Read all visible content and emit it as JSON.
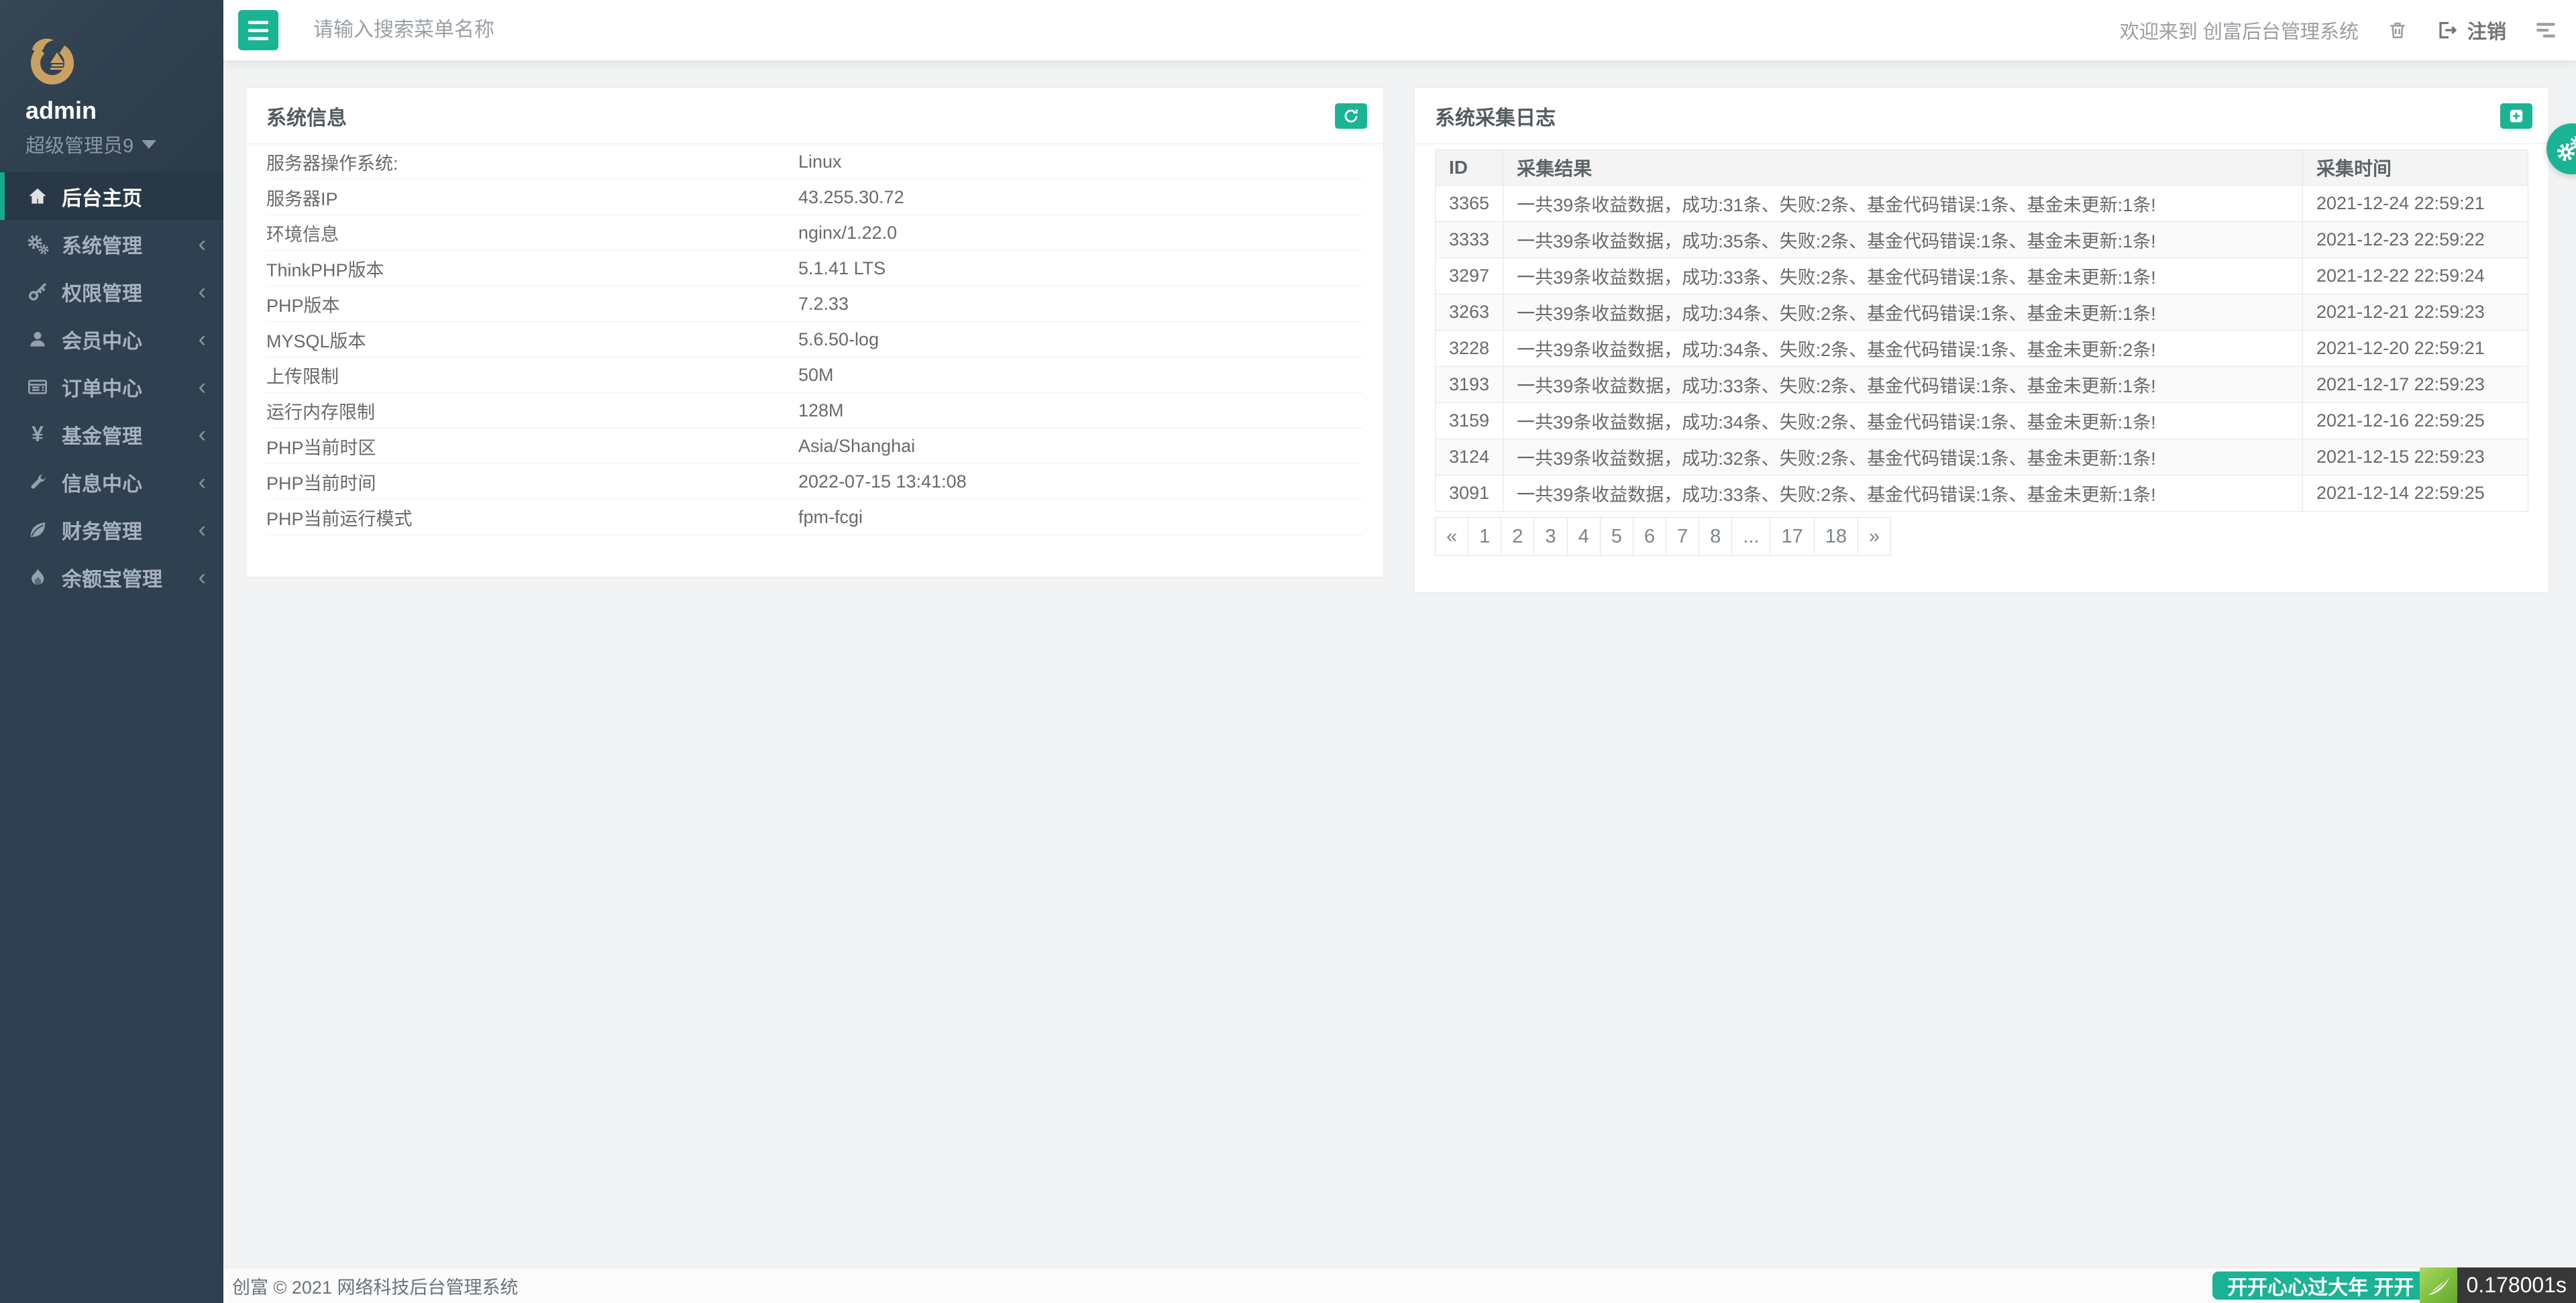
{
  "colors": {
    "accent": "#1ab394",
    "sidebar_bg": "#2f4050",
    "active_border": "#19aa8d",
    "body_bg": "#f2f3f4",
    "gold_logo": "#c9a162",
    "tp_green": "#7fbf3f"
  },
  "sidebar": {
    "username": "admin",
    "role": "超级管理员9",
    "menu": [
      {
        "label": "后台主页",
        "icon": "home-icon",
        "active": true
      },
      {
        "label": "系统管理",
        "icon": "gears-icon",
        "chevron": "‹"
      },
      {
        "label": "权限管理",
        "icon": "key-icon",
        "chevron": "‹"
      },
      {
        "label": "会员中心",
        "icon": "user-icon",
        "chevron": "‹"
      },
      {
        "label": "订单中心",
        "icon": "order-list-icon",
        "chevron": "‹"
      },
      {
        "label": "基金管理",
        "icon": "yen-icon",
        "chevron": "‹",
        "yen": "¥"
      },
      {
        "label": "信息中心",
        "icon": "wrench-icon",
        "chevron": "‹"
      },
      {
        "label": "财务管理",
        "icon": "leaf-icon",
        "chevron": "‹"
      },
      {
        "label": "余额宝管理",
        "icon": "flame-icon",
        "chevron": "‹"
      }
    ]
  },
  "topbar": {
    "search_placeholder": "请输入搜索菜单名称",
    "welcome": "欢迎来到 创富后台管理系统",
    "logout_label": "注销"
  },
  "panels": {
    "system_info": {
      "title": "系统信息",
      "rows": [
        {
          "label": "服务器操作系统:",
          "value": "Linux"
        },
        {
          "label": "服务器IP",
          "value": "43.255.30.72"
        },
        {
          "label": "环境信息",
          "value": "nginx/1.22.0"
        },
        {
          "label": "ThinkPHP版本",
          "value": "5.1.41 LTS"
        },
        {
          "label": "PHP版本",
          "value": "7.2.33"
        },
        {
          "label": "MYSQL版本",
          "value": "5.6.50-log"
        },
        {
          "label": "上传限制",
          "value": "50M"
        },
        {
          "label": "运行内存限制",
          "value": "128M"
        },
        {
          "label": "PHP当前时区",
          "value": "Asia/Shanghai"
        },
        {
          "label": "PHP当前时间",
          "value": "2022-07-15 13:41:08"
        },
        {
          "label": "PHP当前运行模式",
          "value": "fpm-fcgi"
        }
      ]
    },
    "collect_log": {
      "title": "系统采集日志",
      "columns": {
        "id": "ID",
        "result": "采集结果",
        "time": "采集时间"
      },
      "rows": [
        {
          "id": "3365",
          "result": "一共39条收益数据，成功:31条、失败:2条、基金代码错误:1条、基金未更新:1条!",
          "time": "2021-12-24 22:59:21"
        },
        {
          "id": "3333",
          "result": "一共39条收益数据，成功:35条、失败:2条、基金代码错误:1条、基金未更新:1条!",
          "time": "2021-12-23 22:59:22"
        },
        {
          "id": "3297",
          "result": "一共39条收益数据，成功:33条、失败:2条、基金代码错误:1条、基金未更新:1条!",
          "time": "2021-12-22 22:59:24"
        },
        {
          "id": "3263",
          "result": "一共39条收益数据，成功:34条、失败:2条、基金代码错误:1条、基金未更新:1条!",
          "time": "2021-12-21 22:59:23"
        },
        {
          "id": "3228",
          "result": "一共39条收益数据，成功:34条、失败:2条、基金代码错误:1条、基金未更新:2条!",
          "time": "2021-12-20 22:59:21"
        },
        {
          "id": "3193",
          "result": "一共39条收益数据，成功:33条、失败:2条、基金代码错误:1条、基金未更新:1条!",
          "time": "2021-12-17 22:59:23"
        },
        {
          "id": "3159",
          "result": "一共39条收益数据，成功:34条、失败:2条、基金代码错误:1条、基金未更新:1条!",
          "time": "2021-12-16 22:59:25"
        },
        {
          "id": "3124",
          "result": "一共39条收益数据，成功:32条、失败:2条、基金代码错误:1条、基金未更新:1条!",
          "time": "2021-12-15 22:59:23"
        },
        {
          "id": "3091",
          "result": "一共39条收益数据，成功:33条、失败:2条、基金代码错误:1条、基金未更新:1条!",
          "time": "2021-12-14 22:59:25"
        }
      ],
      "pagination": [
        "«",
        "1",
        "2",
        "3",
        "4",
        "5",
        "6",
        "7",
        "8",
        "...",
        "17",
        "18",
        "»"
      ]
    }
  },
  "footer": {
    "copyright": "创富 © 2021 网络科技后台管理系统"
  },
  "debug_badge": {
    "message": "开开心心过大年 开开",
    "time": "0.178001s"
  }
}
